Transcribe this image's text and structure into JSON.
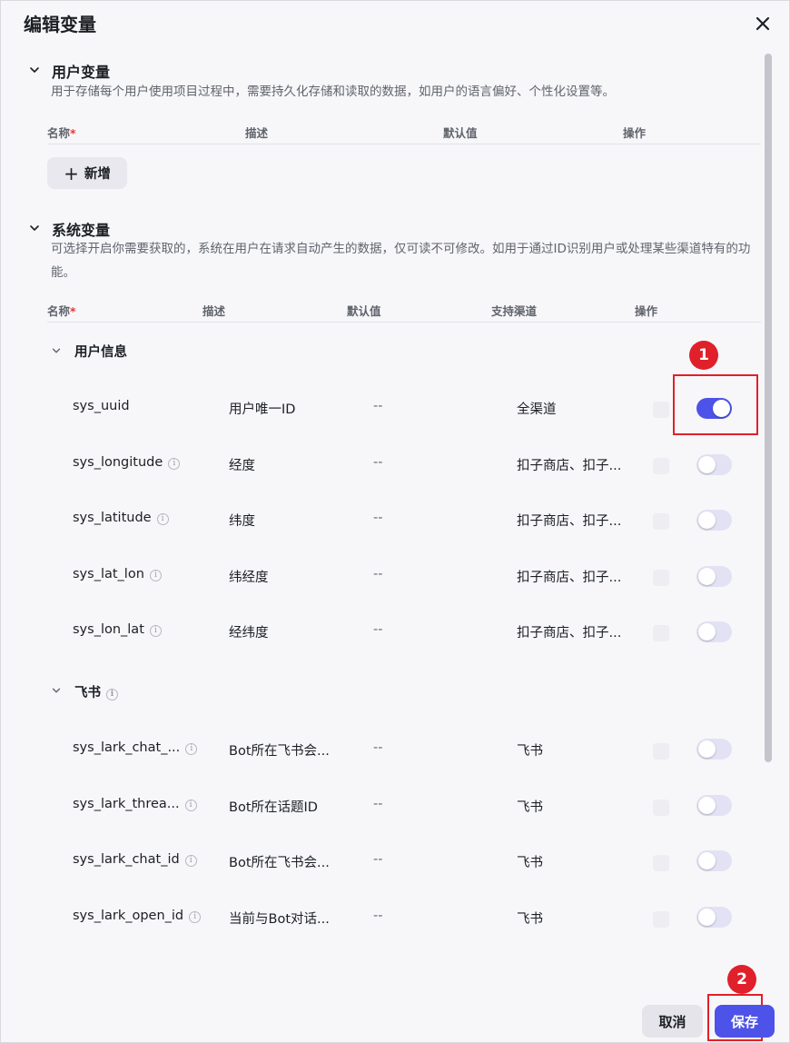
{
  "dialog": {
    "title": "编辑变量"
  },
  "user_section": {
    "title": "用户变量",
    "description": "用于存储每个用户使用项目过程中，需要持久化存储和读取的数据，如用户的语言偏好、个性化设置等。",
    "columns": {
      "name": "名称",
      "required_mark": "*",
      "desc": "描述",
      "default": "默认值",
      "action": "操作"
    },
    "add_button": "新增"
  },
  "system_section": {
    "title": "系统变量",
    "description": "可选择开启你需要获取的，系统在用户在请求自动产生的数据，仅可读不可修改。如用于通过ID识别用户或处理某些渠道特有的功能。",
    "columns": {
      "name": "名称",
      "required_mark": "*",
      "desc": "描述",
      "default": "默认值",
      "channel": "支持渠道",
      "action": "操作"
    },
    "groups": [
      {
        "title": "用户信息",
        "rows": [
          {
            "name": "sys_uuid",
            "info": false,
            "desc": "用户唯一ID",
            "default": "--",
            "channel": "全渠道",
            "enabled": true
          },
          {
            "name": "sys_longitude",
            "info": true,
            "desc": "经度",
            "default": "--",
            "channel": "扣子商店、扣子...",
            "enabled": false
          },
          {
            "name": "sys_latitude",
            "info": true,
            "desc": "纬度",
            "default": "--",
            "channel": "扣子商店、扣子...",
            "enabled": false
          },
          {
            "name": "sys_lat_lon",
            "info": true,
            "desc": "纬经度",
            "default": "--",
            "channel": "扣子商店、扣子...",
            "enabled": false
          },
          {
            "name": "sys_lon_lat",
            "info": true,
            "desc": "经纬度",
            "default": "--",
            "channel": "扣子商店、扣子...",
            "enabled": false
          }
        ]
      },
      {
        "title": "飞书",
        "title_info": true,
        "rows": [
          {
            "name": "sys_lark_chat_...",
            "info": true,
            "desc": "Bot所在飞书会...",
            "default": "--",
            "channel": "飞书",
            "enabled": false
          },
          {
            "name": "sys_lark_threa...",
            "info": true,
            "desc": "Bot所在话题ID",
            "default": "--",
            "channel": "飞书",
            "enabled": false
          },
          {
            "name": "sys_lark_chat_id",
            "info": true,
            "desc": "Bot所在飞书会...",
            "default": "--",
            "channel": "飞书",
            "enabled": false
          },
          {
            "name": "sys_lark_open_id",
            "info": true,
            "desc": "当前与Bot对话...",
            "default": "--",
            "channel": "飞书",
            "enabled": false
          }
        ]
      }
    ]
  },
  "footer": {
    "cancel": "取消",
    "save": "保存"
  },
  "annotations": [
    {
      "label": "1"
    },
    {
      "label": "2"
    }
  ],
  "colors": {
    "primary": "#4d53e8",
    "annotation": "#e0202a",
    "toggle_off": "#e2e2f4"
  }
}
